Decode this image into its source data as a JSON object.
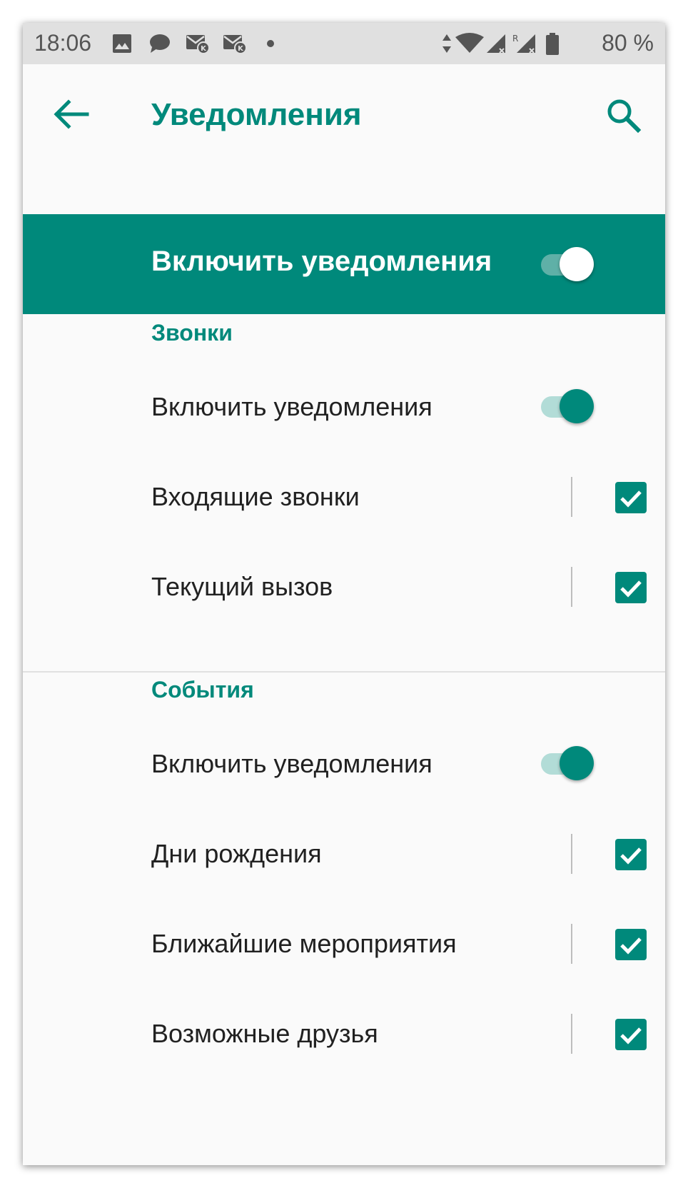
{
  "status_bar": {
    "time": "18:06",
    "battery": "80 %",
    "icons": [
      "image-icon",
      "chat-icon",
      "kaspersky-mail-icon",
      "kaspersky-mail-icon",
      "dot-icon",
      "data-arrows-icon",
      "wifi-icon",
      "signal-icon",
      "roaming-signal-icon",
      "battery-icon"
    ]
  },
  "toolbar": {
    "title": "Уведомления",
    "back_icon": "arrow-left-icon",
    "search_icon": "search-icon"
  },
  "master_switch": {
    "label": "Включить уведомления",
    "on": true
  },
  "sections": [
    {
      "header": "Звонки",
      "switch_label": "Включить уведомления",
      "switch_on": true,
      "items": [
        {
          "label": "Входящие звонки",
          "checked": true
        },
        {
          "label": "Текущий вызов",
          "checked": true
        }
      ]
    },
    {
      "header": "События",
      "switch_label": "Включить уведомления",
      "switch_on": true,
      "items": [
        {
          "label": "Дни рождения",
          "checked": true
        },
        {
          "label": "Ближайшие мероприятия",
          "checked": true
        },
        {
          "label": "Возможные друзья",
          "checked": true
        }
      ]
    }
  ],
  "colors": {
    "accent": "#00897b",
    "status_bar": "#e0e0e0",
    "background": "#fafafa",
    "text": "#212121"
  }
}
